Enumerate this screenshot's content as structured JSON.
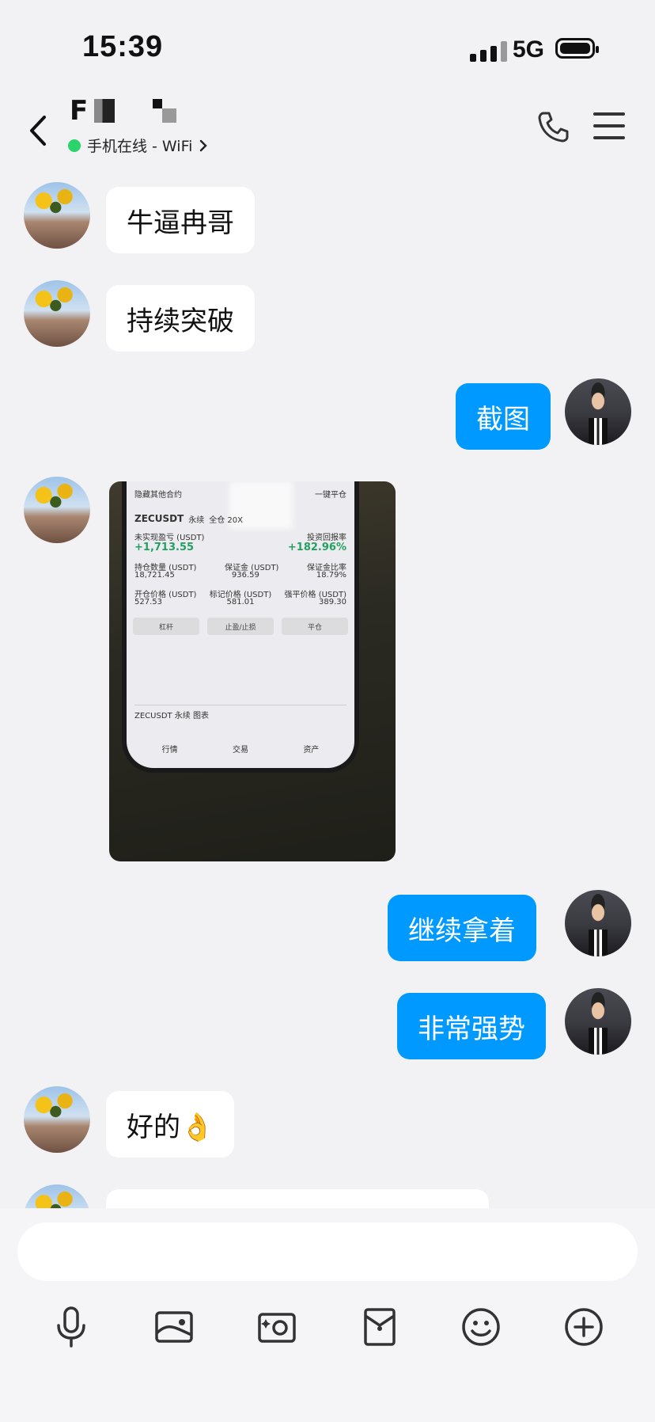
{
  "status": {
    "time": "15:39",
    "network": "5G"
  },
  "header": {
    "contact_name": "F",
    "presence": "手机在线 - WiFi"
  },
  "messages": [
    {
      "side": "in",
      "text": "牛逼冉哥"
    },
    {
      "side": "in",
      "text": "持续突破"
    },
    {
      "side": "out",
      "text": "截图"
    },
    {
      "side": "in",
      "type": "image"
    },
    {
      "side": "out",
      "text": "继续拿着"
    },
    {
      "side": "out",
      "text": "非常强势"
    },
    {
      "side": "in",
      "text": "好的👌"
    }
  ],
  "screenshot": {
    "hide_other": "隐藏其他合约",
    "close_all": "一键平仓",
    "symbol": "ZECUSDT",
    "contract": "永续",
    "mode": "全仓 20X",
    "pnl_label": "未实现盈亏 (USDT)",
    "pnl_value": "+1,713.55",
    "roi_label": "投资回报率",
    "roi_value": "+182.96%",
    "qty_label": "持仓数量 (USDT)",
    "qty_value": "18,721.45",
    "margin_label": "保证金 (USDT)",
    "margin_value": "936.59",
    "margin_ratio_label": "保证金比率",
    "margin_ratio_value": "18.79%",
    "open_label": "开仓价格 (USDT)",
    "open_value": "527.53",
    "mark_label": "标记价格 (USDT)",
    "mark_value": "581.01",
    "liq_label": "强平价格 (USDT)",
    "liq_value": "389.30",
    "btn_leverage": "杠杆",
    "btn_tpsl": "止盈/止损",
    "btn_close": "平仓",
    "chart_label": "ZECUSDT 永续 图表",
    "tab_market": "行情",
    "tab_trade": "交易",
    "tab_assets": "资产"
  },
  "toolbar": {
    "icons": [
      "microphone-icon",
      "photo-icon",
      "camera-icon",
      "red-packet-icon",
      "emoji-icon",
      "plus-icon"
    ]
  }
}
